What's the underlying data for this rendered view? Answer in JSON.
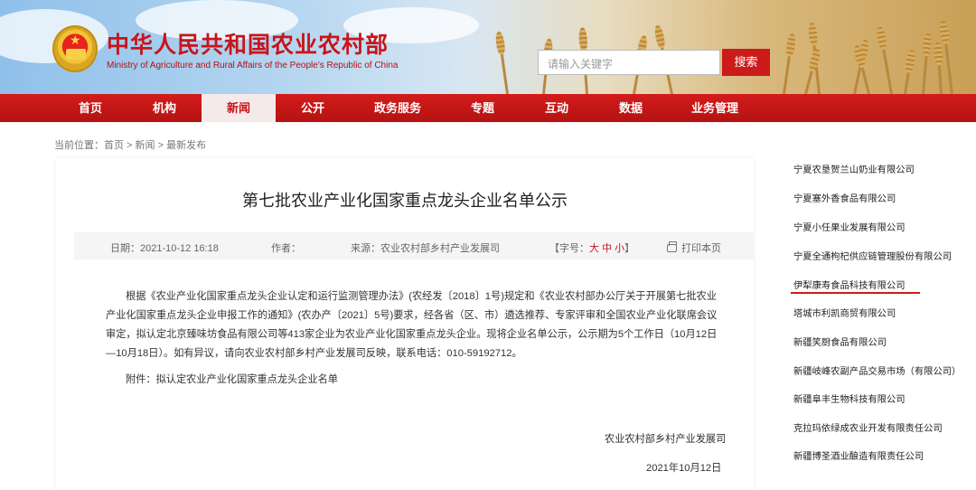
{
  "header": {
    "site_title": "中华人民共和国农业农村部",
    "site_subtitle": "Ministry of Agriculture and Rural Affairs of the People's Republic of China",
    "search_placeholder": "请输入关键字",
    "search_button": "搜索",
    "emblem_icon": "national-emblem-icon"
  },
  "nav": {
    "items": [
      {
        "label": "首页"
      },
      {
        "label": "机构"
      },
      {
        "label": "新闻"
      },
      {
        "label": "公开"
      },
      {
        "label": "政务服务"
      },
      {
        "label": "专题"
      },
      {
        "label": "互动"
      },
      {
        "label": "数据"
      },
      {
        "label": "业务管理"
      }
    ],
    "active": "新闻"
  },
  "breadcrumb": "当前位置：首页 > 新闻 > 最新发布",
  "article": {
    "title": "第七批农业产业化国家重点龙头企业名单公示",
    "date": "日期：2021-10-12 16:18",
    "author": "作者：",
    "source": "来源：农业农村部乡村产业发展司",
    "font_size_prefix": "【字号：",
    "font_large": "大",
    "font_medium": "中",
    "font_small": "小",
    "font_size_suffix": "】",
    "print": "打印本页",
    "body": "根据《农业产业化国家重点龙头企业认定和运行监测管理办法》(农经发〔2018〕1号)规定和《农业农村部办公厅关于开展第七批农业产业化国家重点龙头企业申报工作的通知》(农办产〔2021〕5号)要求，经各省（区、市）遴选推荐、专家评审和全国农业产业化联席会议审定，拟认定北京臻味坊食品有限公司等413家企业为农业产业化国家重点龙头企业。现将企业名单公示，公示期为5个工作日（10月12日—10月18日）。如有异议，请向农业农村部乡村产业发展司反映，联系电话：010-59192712。",
    "attachment": "附件：拟认定农业产业化国家重点龙头企业名单",
    "signature": "农业农村部乡村产业发展司",
    "sign_date": "2021年10月12日"
  },
  "companies": [
    "宁夏农垦贺兰山奶业有限公司",
    "宁夏塞外香食品有限公司",
    "宁夏小任果业发展有限公司",
    "宁夏全通枸杞供应链管理股份有限公司",
    "伊犁康寿食品科技有限公司",
    "塔城市利凯商贸有限公司",
    "新疆笑厨食品有限公司",
    "新疆岐峰农副产品交易市场（有限公司）",
    "新疆阜丰生物科技有限公司",
    "克拉玛依绿成农业开发有限责任公司",
    "新疆博圣酒业酿造有限责任公司"
  ],
  "colors": {
    "brand_red": "#c8141b",
    "nav_red": "#c41616"
  }
}
